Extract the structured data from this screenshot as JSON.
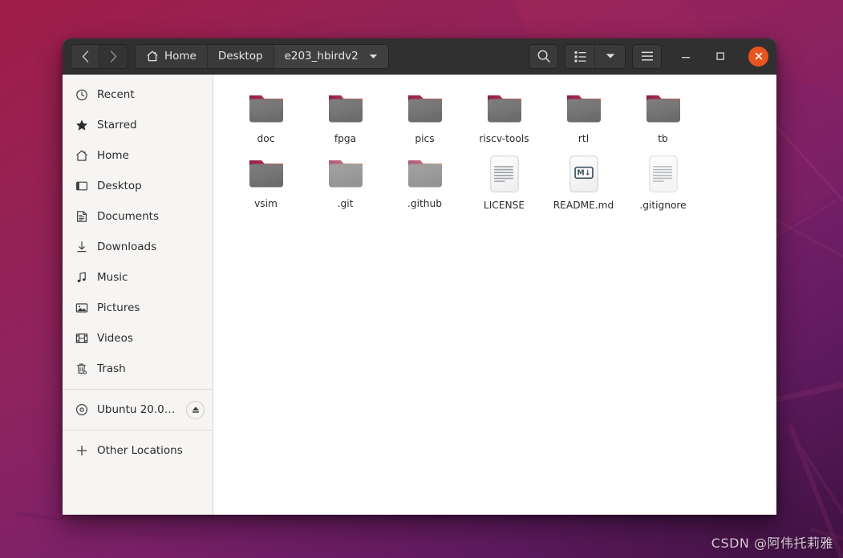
{
  "desktop": {
    "wallpaper_name": "ubuntu-2004-wallpaper",
    "colors": {
      "top": "#a01d47",
      "mid": "#8d2360",
      "bottom": "#3d1140"
    }
  },
  "watermark": {
    "text": "CSDN @阿伟托莉雅"
  },
  "window": {
    "title": "e203_hbirdv2",
    "accent": "#e95420",
    "header_bg": "#303030"
  },
  "nav": {
    "back_label": "‹",
    "forward_label": "›"
  },
  "pathbar": {
    "items": [
      {
        "label": "Home",
        "icon": "home-icon",
        "current": false
      },
      {
        "label": "Desktop",
        "icon": "",
        "current": false
      },
      {
        "label": "e203_hbirdv2",
        "icon": "",
        "current": true
      }
    ],
    "dropdown_label": "▼"
  },
  "toolbar": {
    "search_label": "search-icon",
    "view_list_label": "view-list-icon",
    "view_dropdown_label": "▼",
    "menu_label": "hamburger-menu-icon",
    "minimize_label": "–",
    "maximize_label": "□",
    "close_label": "✕"
  },
  "sidebar": {
    "items": [
      {
        "label": "Recent",
        "icon": "clock-icon",
        "type": "place"
      },
      {
        "label": "Starred",
        "icon": "star-icon",
        "type": "place"
      },
      {
        "label": "Home",
        "icon": "home-icon",
        "type": "place"
      },
      {
        "label": "Desktop",
        "icon": "desktop-icon",
        "type": "place"
      },
      {
        "label": "Documents",
        "icon": "documents-icon",
        "type": "place"
      },
      {
        "label": "Downloads",
        "icon": "download-icon",
        "type": "place"
      },
      {
        "label": "Music",
        "icon": "music-note-icon",
        "type": "place"
      },
      {
        "label": "Pictures",
        "icon": "picture-icon",
        "type": "place"
      },
      {
        "label": "Videos",
        "icon": "video-film-icon",
        "type": "place"
      },
      {
        "label": "Trash",
        "icon": "trash-icon",
        "type": "place"
      }
    ],
    "devices": [
      {
        "label": "Ubuntu 20.0…",
        "icon": "disc-icon",
        "eject": "eject-icon"
      }
    ],
    "network": [
      {
        "label": "Other Locations",
        "icon": "plus-icon"
      }
    ]
  },
  "files": [
    {
      "name": "doc",
      "kind": "folder",
      "hidden": false
    },
    {
      "name": "fpga",
      "kind": "folder",
      "hidden": false
    },
    {
      "name": "pics",
      "kind": "folder",
      "hidden": false
    },
    {
      "name": "riscv-tools",
      "kind": "folder",
      "hidden": false
    },
    {
      "name": "rtl",
      "kind": "folder",
      "hidden": false
    },
    {
      "name": "tb",
      "kind": "folder",
      "hidden": false
    },
    {
      "name": "vsim",
      "kind": "folder",
      "hidden": false
    },
    {
      "name": ".git",
      "kind": "folder",
      "hidden": true
    },
    {
      "name": ".github",
      "kind": "folder",
      "hidden": true
    },
    {
      "name": "LICENSE",
      "kind": "text-document",
      "hidden": false
    },
    {
      "name": "README.md",
      "kind": "markdown-document",
      "hidden": false
    },
    {
      "name": ".gitignore",
      "kind": "text-document",
      "hidden": true
    }
  ],
  "icons": {
    "folder_tab_start": "#8e1d50",
    "folder_tab_end": "#ec5b20",
    "folder_body": "#777777",
    "markdown_badge": "M↓"
  }
}
